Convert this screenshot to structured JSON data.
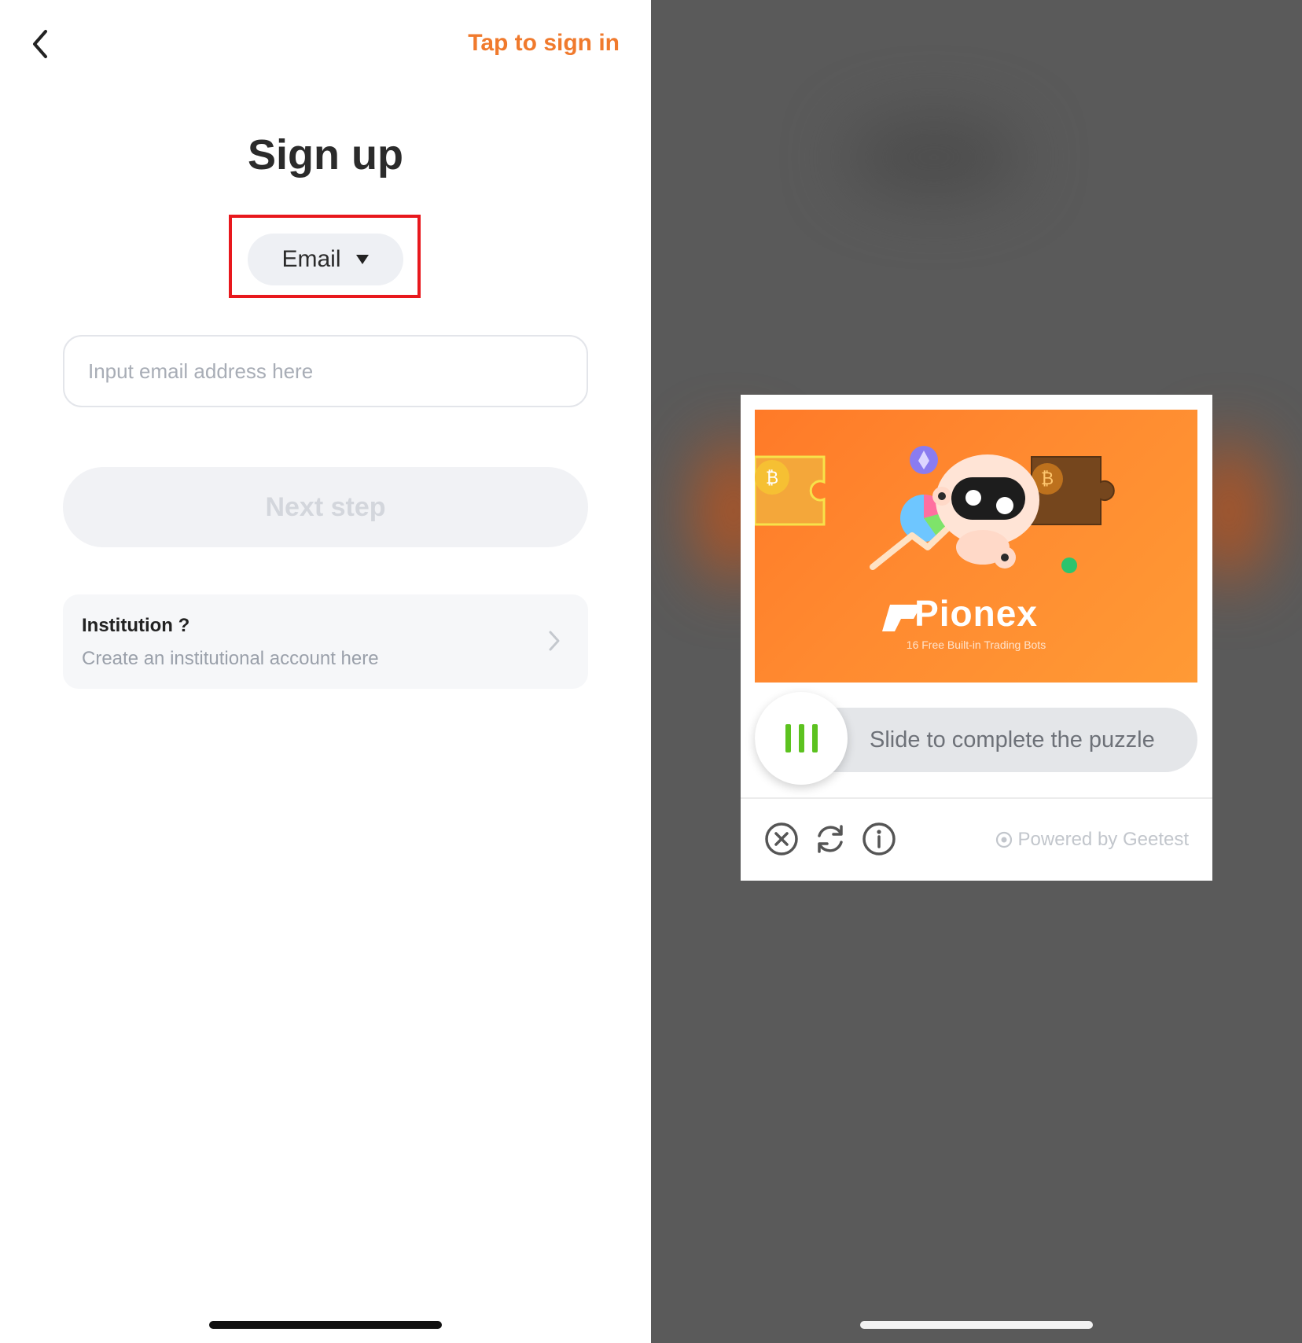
{
  "header": {
    "sign_in_link": "Tap to sign in"
  },
  "title": "Sign up",
  "method_selector": {
    "selected": "Email"
  },
  "email_field": {
    "placeholder": "Input email address here"
  },
  "next_button": {
    "label": "Next step"
  },
  "institution": {
    "title": "Institution ?",
    "subtitle": "Create an institutional account here"
  },
  "captcha": {
    "brand": "Pionex",
    "brand_tagline": "16 Free Built-in Trading Bots",
    "slider_prompt": "Slide to complete the puzzle",
    "powered_by": "Powered by Geetest",
    "slider_position": 0,
    "icons": [
      "close-circle-icon",
      "refresh-icon",
      "info-icon"
    ]
  },
  "colors": {
    "accent": "#f07a2d",
    "highlight": "#e8181d",
    "slider_grip": "#5cc21f",
    "overlay": "#5a5a5a"
  }
}
